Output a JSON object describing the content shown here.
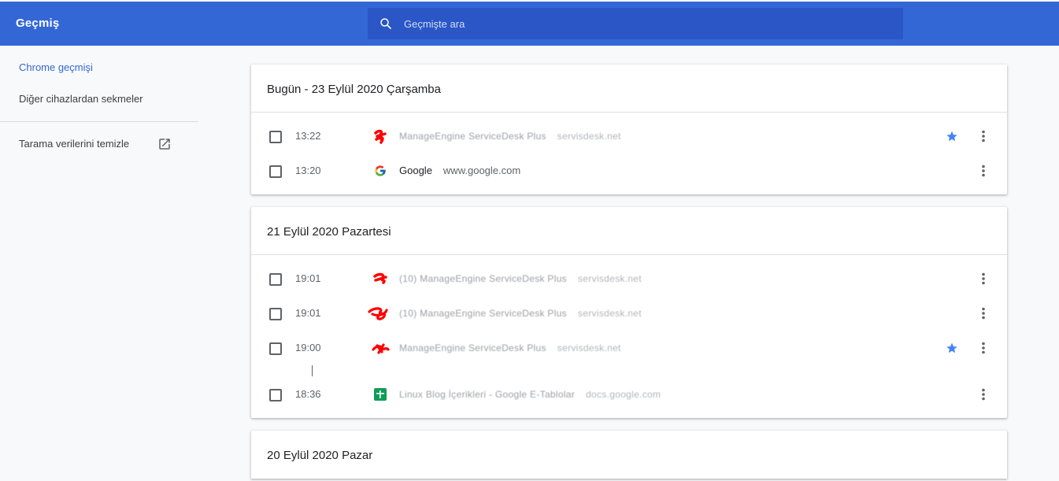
{
  "toolbar": {
    "title": "Geçmiş",
    "search_placeholder": "Geçmişte ara"
  },
  "sidebar": {
    "items": [
      {
        "label": "Chrome geçmişi",
        "selected": true
      },
      {
        "label": "Diğer cihazlardan sekmeler",
        "selected": false
      }
    ],
    "clear_label": "Tarama verilerini temizle"
  },
  "groups": [
    {
      "date": "Bugün - 23 Eylül 2020 Çarşamba",
      "entries": [
        {
          "time": "13:22",
          "title": "ManageEngine ServiceDesk Plus",
          "domain": "servisdesk.net",
          "starred": true,
          "favicon": "redacted-icon"
        },
        {
          "time": "13:20",
          "title": "Google",
          "domain": "www.google.com",
          "starred": false,
          "favicon": "google-icon"
        }
      ]
    },
    {
      "date": "21 Eylül 2020 Pazartesi",
      "entries": [
        {
          "time": "19:01",
          "title": "(10) ManageEngine ServiceDesk Plus",
          "domain": "servisdesk.net",
          "starred": false,
          "favicon": "redacted-icon"
        },
        {
          "time": "19:01",
          "title": "(10) ManageEngine ServiceDesk Plus",
          "domain": "servisdesk.net",
          "starred": false,
          "favicon": "redacted-icon"
        },
        {
          "time": "19:00",
          "title": "ManageEngine ServiceDesk Plus",
          "domain": "servisdesk.net",
          "starred": true,
          "favicon": "redacted-icon"
        },
        {
          "time": "18:36",
          "title": "Linux Blog İçerikleri - Google E-Tablolar",
          "domain": "docs.google.com",
          "starred": false,
          "favicon": "sheets-icon"
        }
      ]
    },
    {
      "date": "20 Eylül 2020 Pazar",
      "entries": []
    }
  ],
  "colors": {
    "toolbar": "#3367d6",
    "search_bg": "#2a56c6",
    "accent": "#3367d6",
    "star": "#4285f4",
    "redaction": "#ff0000"
  }
}
